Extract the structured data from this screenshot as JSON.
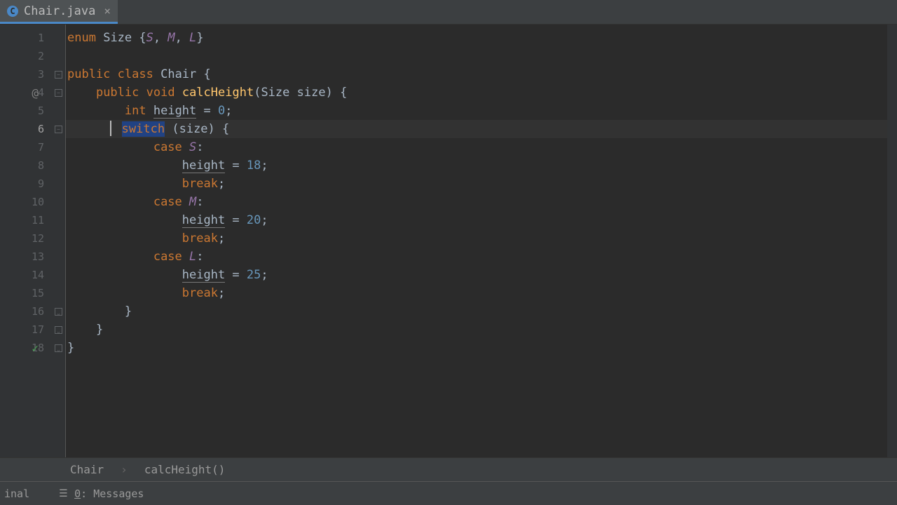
{
  "tab": {
    "filename": "Chair.java",
    "icon_letter": "C"
  },
  "code": {
    "line1": {
      "kw1": "enum",
      "name": "Size",
      "body_open": "{",
      "s": "S",
      "c1": ", ",
      "m": "M",
      "c2": ", ",
      "l": "L",
      "body_close": "}"
    },
    "line3": {
      "kw1": "public",
      "kw2": "class",
      "name": "Chair",
      "brace": "{"
    },
    "line4": {
      "kw1": "public",
      "kw2": "void",
      "fname": "calcHeight",
      "paren_open": "(",
      "ptype": "Size",
      "pname": "size",
      "paren_close": ")",
      "brace": "{"
    },
    "line5": {
      "kw": "int",
      "var": "height",
      "eq": "=",
      "val": "0",
      "semi": ";"
    },
    "line6": {
      "kw": "switch",
      "paren_open": "(",
      "expr": "size",
      "paren_close": ")",
      "brace": "{"
    },
    "line7": {
      "kw": "case ",
      "val": "S",
      "colon": ":"
    },
    "line8": {
      "var": "height",
      "eq": " = ",
      "val": "18",
      "semi": ";"
    },
    "line9": {
      "kw": "break",
      "semi": ";"
    },
    "line10": {
      "kw": "case ",
      "val": "M",
      "colon": ":"
    },
    "line11": {
      "var": "height",
      "eq": " = ",
      "val": "20",
      "semi": ";"
    },
    "line12": {
      "kw": "break",
      "semi": ";"
    },
    "line13": {
      "kw": "case ",
      "val": "L",
      "colon": ":"
    },
    "line14": {
      "var": "height",
      "eq": " = ",
      "val": "25",
      "semi": ";"
    },
    "line15": {
      "kw": "break",
      "semi": ";"
    },
    "line16": {
      "brace": "}"
    },
    "line17": {
      "brace": "}"
    },
    "line18": {
      "brace": "}"
    }
  },
  "line_numbers": [
    "1",
    "2",
    "3",
    "4",
    "5",
    "6",
    "7",
    "8",
    "9",
    "10",
    "11",
    "12",
    "13",
    "14",
    "15",
    "16",
    "17",
    "18"
  ],
  "breadcrumb": {
    "class": "Chair",
    "method": "calcHeight()"
  },
  "bottom": {
    "terminal": "inal",
    "messages_num": "0",
    "messages_label": ": Messages"
  }
}
